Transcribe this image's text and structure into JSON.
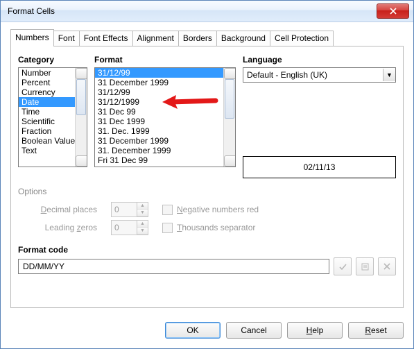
{
  "window": {
    "title": "Format Cells"
  },
  "tabs": [
    "Numbers",
    "Font",
    "Font Effects",
    "Alignment",
    "Borders",
    "Background",
    "Cell Protection"
  ],
  "active_tab": 0,
  "category": {
    "label": "Category",
    "items": [
      "Number",
      "Percent",
      "Currency",
      "Date",
      "Time",
      "Scientific",
      "Fraction",
      "Boolean Value",
      "Text"
    ],
    "selected": 3
  },
  "format": {
    "label": "Format",
    "items": [
      "31/12/99",
      "31 December 1999",
      "31/12/99",
      "31/12/1999",
      "31 Dec 99",
      "31 Dec 1999",
      "31. Dec. 1999",
      "31 December 1999",
      "31. December 1999",
      "Fri 31 Dec 99"
    ],
    "selected": 0
  },
  "language": {
    "label": "Language",
    "value": "Default - English (UK)"
  },
  "preview": "02/11/13",
  "options": {
    "header": "Options",
    "decimal_label": "Decimal places",
    "decimal_value": "0",
    "leading_label": "Leading zeros",
    "leading_value": "0",
    "negative_label": "Negative numbers red",
    "thousands_label": "Thousands separator"
  },
  "format_code": {
    "label": "Format code",
    "value": "DD/MM/YY"
  },
  "buttons": {
    "ok": "OK",
    "cancel": "Cancel",
    "help": "Help",
    "reset": "Reset"
  }
}
